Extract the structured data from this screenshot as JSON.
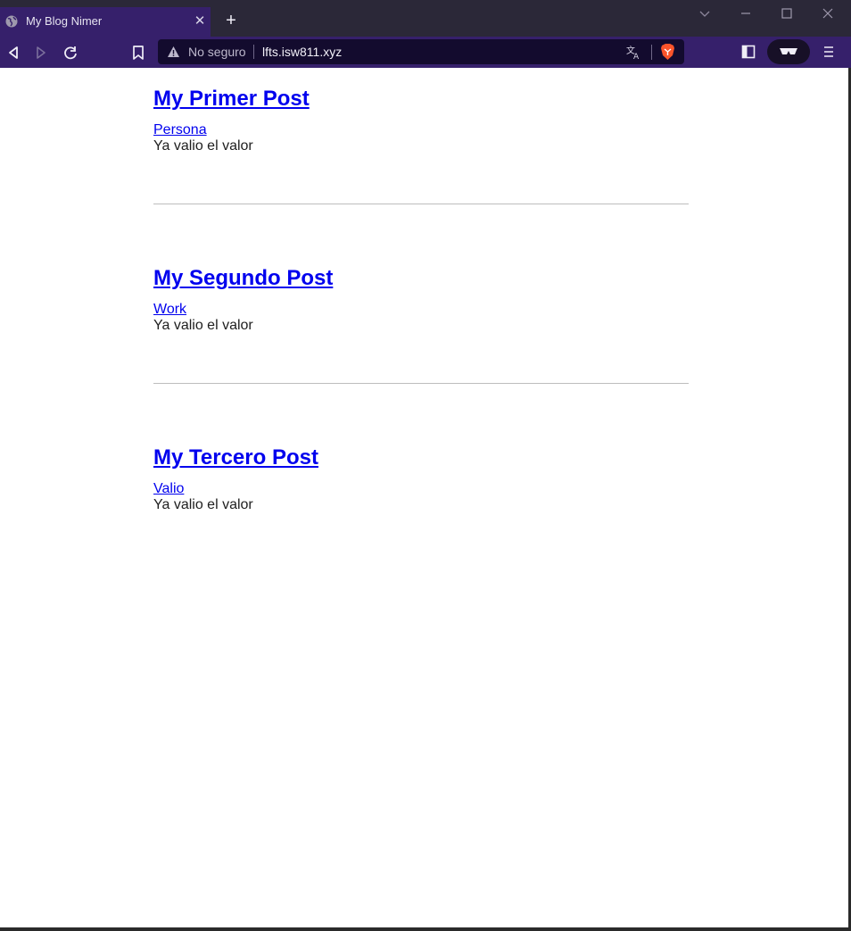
{
  "browser": {
    "tab": {
      "title": "My Blog Nimer"
    },
    "omnibox": {
      "security_label": "No seguro",
      "url": "lfts.isw811.xyz"
    },
    "icons": {
      "tab_favicon": "globe-icon",
      "tab_close": "close-icon",
      "new_tab": "plus-icon",
      "back": "back-icon",
      "forward": "forward-icon",
      "reload": "reload-icon",
      "bookmark": "bookmark-icon",
      "warning": "warning-icon",
      "translate": "translate-icon",
      "brave_shields": "brave-lion-icon",
      "sidebar": "sidebar-icon",
      "private": "private-glasses-icon",
      "menu": "menu-icon"
    },
    "colors": {
      "titlebar": "#2b2838",
      "toolbar": "#36206b",
      "omnibox": "#130b2e"
    }
  },
  "posts": [
    {
      "title": "My Primer Post",
      "category": "Persona",
      "excerpt": "Ya valio el valor"
    },
    {
      "title": "My Segundo Post",
      "category": "Work",
      "excerpt": "Ya valio el valor"
    },
    {
      "title": "My Tercero Post",
      "category": "Valio",
      "excerpt": "Ya valio el valor"
    }
  ],
  "colors": {
    "link": "#0000ee",
    "text": "#202020",
    "divider": "#bdbdbd"
  }
}
